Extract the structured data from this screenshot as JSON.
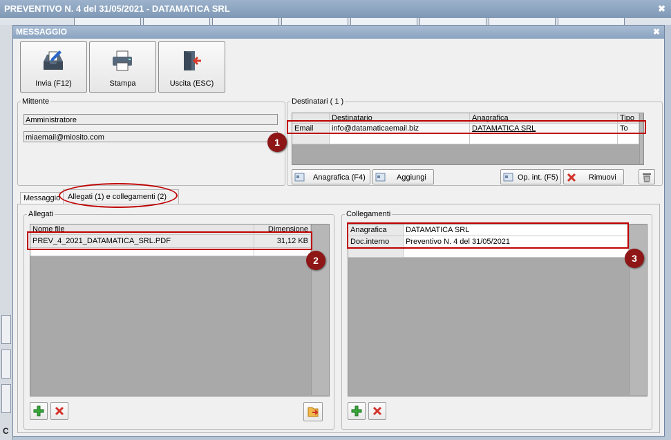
{
  "window": {
    "title": "PREVENTIVO N. 4 del 31/05/2021 - DATAMATICA SRL",
    "close_glyph": "✖"
  },
  "dialog": {
    "title": "MESSAGGIO",
    "close_glyph": "✖"
  },
  "toolbar": {
    "send_label": "Invia (F12)",
    "print_label": "Stampa",
    "exit_label": "Uscita (ESC)"
  },
  "sender": {
    "legend": "Mittente",
    "name": "Amministratore",
    "email": "miaemail@miosito.com"
  },
  "recipients": {
    "legend": "Destinatari ( 1 )",
    "columns": [
      "Destinatario",
      "Anagrafica",
      "Tipo"
    ],
    "rows": [
      {
        "kind": "Email",
        "recipient": "info@datamaticaemail.biz",
        "registry": "DATAMATICA SRL",
        "type": "To"
      }
    ],
    "buttons": {
      "registry": "Anagrafica (F4)",
      "add": "Aggiungi",
      "internal": "Op. int. (F5)",
      "remove": "Rimuovi"
    }
  },
  "tabs": [
    {
      "label": "Messaggio"
    },
    {
      "label": "Allegati (1) e collegamenti (2)"
    }
  ],
  "attachments": {
    "legend": "Allegati",
    "columns": [
      "Nome file",
      "Dimensione"
    ],
    "rows": [
      {
        "name": "PREV_4_2021_DATAMATICA_SRL.PDF",
        "size": "31,12 KB"
      }
    ]
  },
  "links": {
    "legend": "Collegamenti",
    "rows": [
      {
        "key": "Anagrafica",
        "value": "DATAMATICA SRL"
      },
      {
        "key": "Doc.interno",
        "value": "Preventivo N. 4 del 31/05/2021"
      }
    ]
  },
  "callouts": [
    "1",
    "2",
    "3"
  ],
  "colors": {
    "callout": "#8e1616",
    "highlight": "#c00000",
    "titlebar": "#8aa3c0"
  },
  "status": {
    "bottom_left_text": "C"
  }
}
